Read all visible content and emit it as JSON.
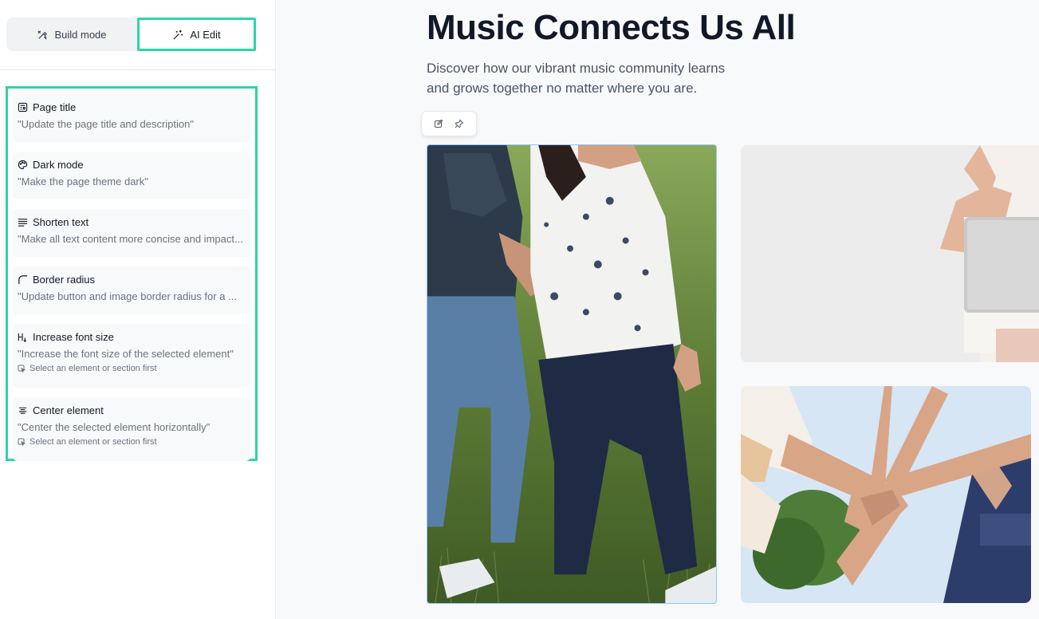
{
  "sidebar": {
    "modes": [
      {
        "label": "Build mode",
        "icon": "tools-icon"
      },
      {
        "label": "AI Edit",
        "icon": "sparkle-wand-icon"
      }
    ],
    "actions": [
      {
        "title": "Page title",
        "desc": "\"Update the page title and description\"",
        "icon": "layout-icon",
        "hint": ""
      },
      {
        "title": "Dark mode",
        "desc": "\"Make the page theme dark\"",
        "icon": "palette-icon",
        "hint": ""
      },
      {
        "title": "Shorten text",
        "desc": "\"Make all text content more concise and impact...",
        "icon": "text-lines-icon",
        "hint": ""
      },
      {
        "title": "Border radius",
        "desc": "\"Update button and image border radius for a ...",
        "icon": "corner-radius-icon",
        "hint": ""
      },
      {
        "title": "Increase font size",
        "desc": "\"Increase the font size of the selected element\"",
        "icon": "heading-size-icon",
        "hint": "Select an element or section first"
      },
      {
        "title": "Center element",
        "desc": "\"Center the selected element horizontally\"",
        "icon": "align-center-icon",
        "hint": "Select an element or section first"
      }
    ]
  },
  "main": {
    "title": "Music Connects Us All",
    "subtitle": "Discover how our vibrant music community learns and grows together no matter where you are.",
    "toolbar": {
      "icons": [
        "edit-icon",
        "pin-icon"
      ]
    },
    "images": [
      {
        "name": "photo-walking-couple",
        "desc_colors": [
          "#5d7a36",
          "#1f2a44"
        ]
      },
      {
        "name": "photo-laptop-person",
        "desc_colors": [
          "#e4e4e4"
        ]
      },
      {
        "name": "photo-stacked-hands",
        "desc_colors": [
          "#cfe2f3"
        ]
      }
    ]
  }
}
